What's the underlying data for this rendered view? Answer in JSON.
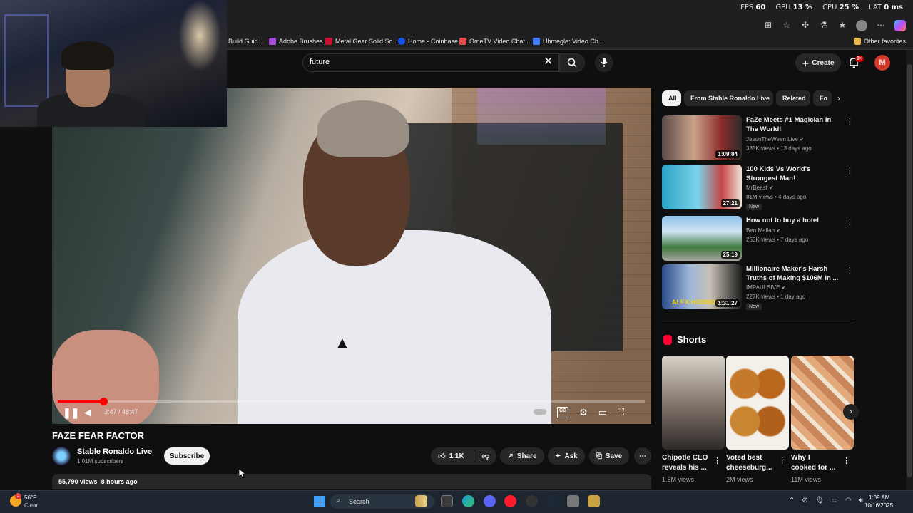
{
  "perf": {
    "fps_label": "FPS",
    "fps": "60",
    "gpu_label": "GPU",
    "gpu": "13 %",
    "cpu_label": "CPU",
    "cpu": "25 %",
    "lat_label": "LAT",
    "lat": "0 ms"
  },
  "bookmarks": [
    {
      "label": "Build Guid...",
      "color": "#2b2b2b"
    },
    {
      "label": "Adobe Brushes",
      "color": "#a54bd6"
    },
    {
      "label": "Metal Gear Solid So...",
      "color": "#c8102e"
    },
    {
      "label": "Home - Coinbase",
      "color": "#1652f0"
    },
    {
      "label": "OmeTV Video Chat...",
      "color": "#e24b4b"
    },
    {
      "label": "Uhmegle: Video Ch...",
      "color": "#3d7bf7"
    }
  ],
  "bookmarks_other": "Other favorites",
  "search": {
    "query": "future"
  },
  "header": {
    "create_label": "Create",
    "notif_badge": "9+",
    "avatar_letter": "M"
  },
  "player": {
    "time": "3:47 / 48:47",
    "progress": 0.078
  },
  "video": {
    "title": "FAZE FEAR FACTOR",
    "channel": "Stable Ronaldo Live",
    "subscribers": "1.01M subscribers",
    "subscribe_label": "Subscribe",
    "likes": "1.1K",
    "share_label": "Share",
    "ask_label": "Ask",
    "save_label": "Save",
    "views": "55,790 views",
    "age": "8 hours ago"
  },
  "chips": [
    "All",
    "From Stable Ronaldo Live",
    "Related",
    "Fo"
  ],
  "recommendations": [
    {
      "title": "FaZe Meets #1 Magician In The World!",
      "channel": "JasonTheWeen Live",
      "meta": "385K views • 13 days ago",
      "duration": "1:09:04",
      "new": ""
    },
    {
      "title": "100 Kids Vs World's Strongest Man!",
      "channel": "MrBeast",
      "meta": "81M views • 4 days ago",
      "duration": "27:21",
      "new": "New"
    },
    {
      "title": "How not to buy a hotel",
      "channel": "Ben Mallah",
      "meta": "253K views • 7 days ago",
      "duration": "25:19",
      "new": ""
    },
    {
      "title": "Millionaire Maker's Harsh Truths of Making $106M in ...",
      "channel": "IMPAULSIVE",
      "meta": "227K views • 1 day ago",
      "duration": "1:31:27",
      "new": "New",
      "thumb_text": "ALEX HORMOZI"
    }
  ],
  "shorts": {
    "label": "Shorts",
    "items": [
      {
        "title": "Chipotle CEO reveals his ...",
        "views": "1.5M views"
      },
      {
        "title": "Voted best cheeseburg...",
        "views": "2M views"
      },
      {
        "title": "Why I cooked for ...",
        "views": "11M views"
      }
    ]
  },
  "taskbar": {
    "temp": "56°F",
    "condition": "Clear",
    "weather_badge": "3",
    "search_label": "Search",
    "time": "1:09 AM",
    "date": "10/16/2025"
  }
}
